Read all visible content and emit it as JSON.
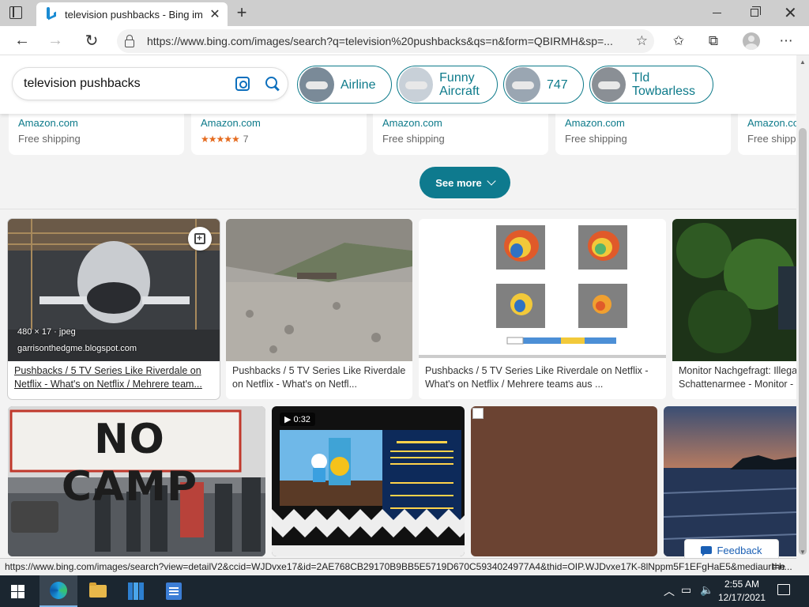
{
  "browser": {
    "tab_title": "television pushbacks - Bing images",
    "url": "https://www.bing.com/images/search?q=television%20pushbacks&qs=n&form=QBIRMH&sp=..."
  },
  "search": {
    "query": "television pushbacks",
    "chips": [
      {
        "label": "Airline"
      },
      {
        "label": "Funny Aircraft"
      },
      {
        "label": "747"
      },
      {
        "label": "Tld Towbarless"
      }
    ]
  },
  "shopping": [
    {
      "vendor": "Amazon.com",
      "shipping": "Free shipping"
    },
    {
      "vendor": "Amazon.com",
      "rating_count": "7",
      "stars": "★★★★★"
    },
    {
      "vendor": "Amazon.com",
      "shipping": "Free shipping"
    },
    {
      "vendor": "Amazon.com",
      "shipping": "Free shipping"
    },
    {
      "vendor": "Amazon.com",
      "shipping": "Free shipping"
    }
  ],
  "see_more_label": "See more",
  "results_row1": [
    {
      "line1": "Pushbacks / 5 TV Series Like Riverdale on",
      "line2": "Netflix - What's on Netflix / Mehrere team...",
      "overlay_size": "480 × 17 · jpeg",
      "overlay_source": "garrisonthedgme.blogspot.com"
    },
    {
      "line1": "Pushbacks / 5 TV Series Like Riverdale",
      "line2": "on Netflix - What's on Netfl..."
    },
    {
      "line1": "Pushbacks / 5 TV Series Like Riverdale on Netflix -",
      "line2": "What's on Netflix / Mehrere teams aus ..."
    },
    {
      "line1": "Monitor Nachgefragt: Illegal",
      "line2": "Schattenarmee - Monitor - D"
    }
  ],
  "results_row2": [
    {
      "sign_text": "NO CAMP"
    },
    {
      "video_duration": "▶ 0:32"
    },
    {},
    {}
  ],
  "feedback_label": "Feedback",
  "status_url": "https://www.bing.com/images/search?view=detailV2&ccid=WJDvxe17&id=2AE768CB29170B9BB5E5719D670C5934024977A4&thid=OIP.WJDvxe17K-8lNppm5F1EFgHaE5&mediaurl=h...",
  "status_right": "the",
  "taskbar": {
    "time": "2:55 AM",
    "date": "12/17/2021"
  }
}
